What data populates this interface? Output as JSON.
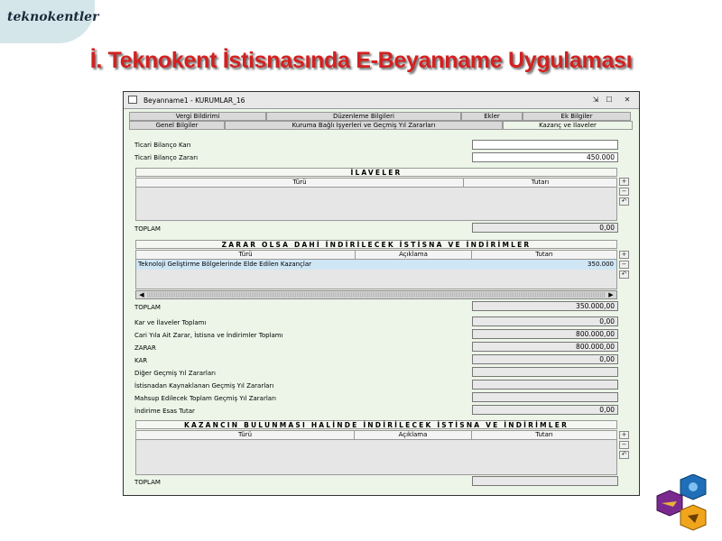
{
  "header": {
    "corner_label": "teknokentler",
    "title": "İ. Teknokent İstisnasında E-Beyanname Uygulaması"
  },
  "window": {
    "title": "Beyanname1 - KURUMLAR_16",
    "tabs_row1": [
      "Vergi Bildirimi",
      "Düzenleme Bilgileri",
      "Ekler",
      "Ek Bilgiler"
    ],
    "tabs_row2": [
      "Genel Bilgiler",
      "Kuruma Bağlı İşyerleri ve Geçmiş Yıl Zararları",
      "Kazanç ve İlaveler"
    ]
  },
  "top_fields": [
    {
      "label": "Ticari Bilanço Karı",
      "value": ""
    },
    {
      "label": "Ticari Bilanço Zararı",
      "value": "450.000"
    }
  ],
  "ilaveler": {
    "title": "İLAVELER",
    "columns": [
      "Türü",
      "Tutarı"
    ],
    "total_label": "TOPLAM",
    "total_value": "0,00"
  },
  "istisna": {
    "title": "ZARAR OLSA DAHİ İNDİRİLECEK İSTİSNA VE İNDİRİMLER",
    "columns": [
      "Türü",
      "Açıklama",
      "Tutarı"
    ],
    "rows": [
      {
        "turu": "Teknoloji Geliştirme Bölgelerinde Elde Edilen Kazançlar",
        "aciklama": "",
        "tutari": "350.000"
      }
    ],
    "total_label": "TOPLAM",
    "total_value": "350.000,00"
  },
  "summary": [
    {
      "label": "Kar ve İlaveler Toplamı",
      "value": "0,00"
    },
    {
      "label": "Cari Yıla Ait Zarar, İstisna ve İndirimler Toplamı",
      "value": "800.000,00"
    },
    {
      "label": "ZARAR",
      "value": "800.000,00"
    },
    {
      "label": "KAR",
      "value": "0,00"
    },
    {
      "label": "Diğer Geçmiş Yıl Zararları",
      "value": ""
    },
    {
      "label": "İstisnadan Kaynaklanan Geçmiş Yıl Zararları",
      "value": ""
    },
    {
      "label": "Mahsup Edilecek Toplam Geçmiş Yıl Zararları",
      "value": ""
    },
    {
      "label": "İndirime Esas Tutar",
      "value": "0,00"
    }
  ],
  "kazanc": {
    "title": "KAZANCIN BULUNMASI HALİNDE İNDİRİLECEK İSTİSNA VE İNDİRİMLER",
    "columns": [
      "Türü",
      "Açıklama",
      "Tutarı"
    ],
    "total_label": "TOPLAM",
    "total_value": ""
  },
  "icons": {
    "window": "form-icon",
    "titlebar": [
      "restore-icon",
      "maximize-icon",
      "close-icon"
    ],
    "side": [
      "add-row-icon",
      "remove-row-icon",
      "undo-icon"
    ],
    "logo": "teknokent-logo-icon"
  },
  "colors": {
    "title": "#d42020",
    "form_bg": "#ecf5e8",
    "selected_row": "#cfe6f5"
  }
}
